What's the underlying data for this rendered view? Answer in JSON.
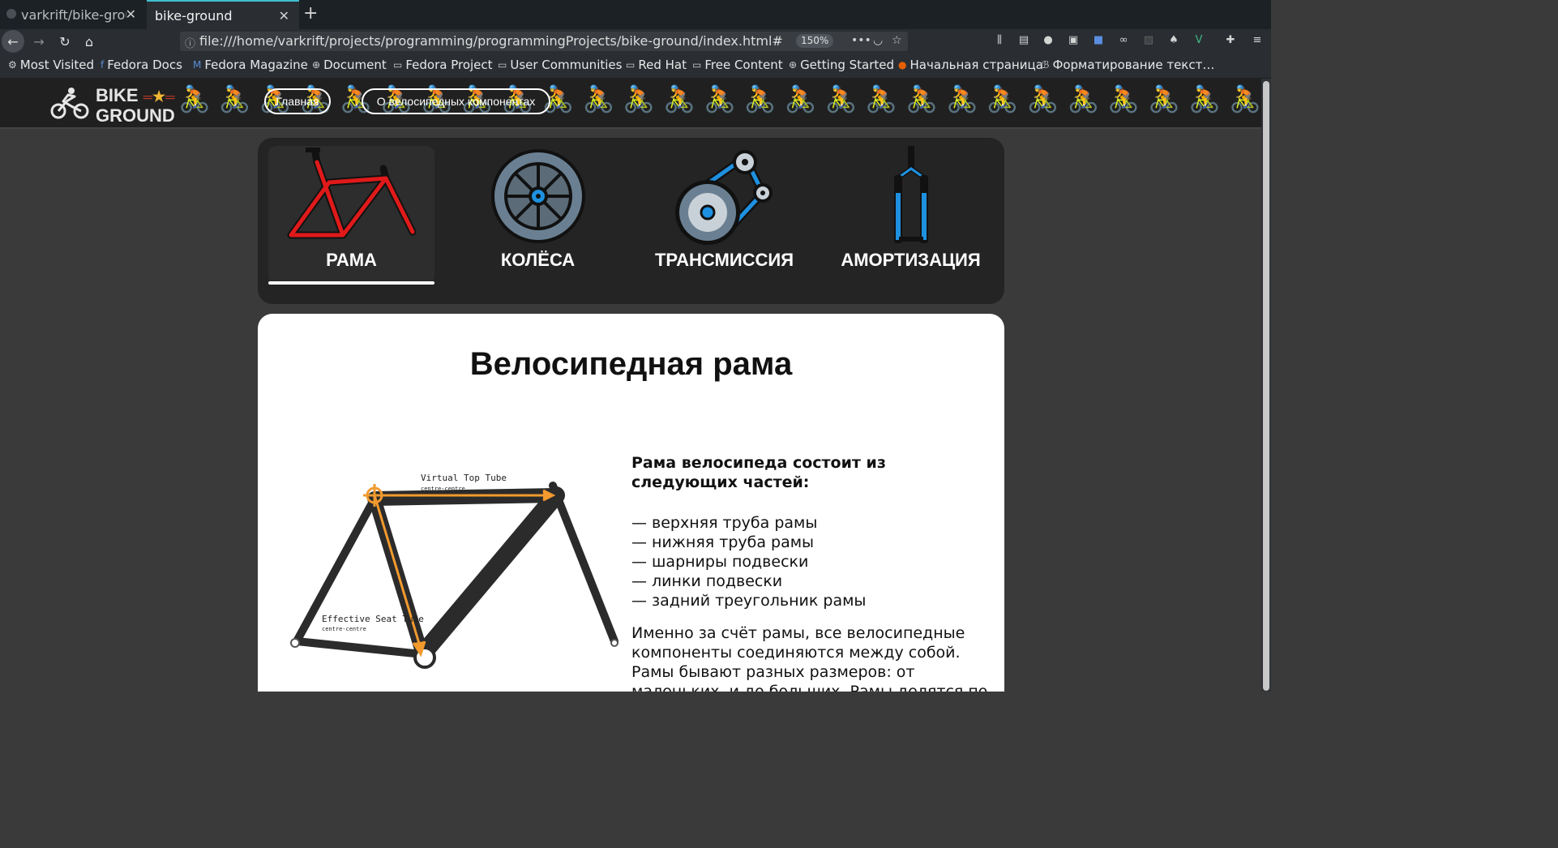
{
  "browser": {
    "tabs": [
      {
        "title": "varkrift/bike-grou",
        "active": false
      },
      {
        "title": "bike-ground",
        "active": true
      }
    ],
    "url": "file:///home/varkrift/projects/programming/programmingProjects/bike-ground/index.html#",
    "zoom": "150%",
    "bookmarks": [
      "Most Visited",
      "Fedora Docs",
      "Fedora Magazine",
      "Document",
      "Fedora Project",
      "User Communities",
      "Red Hat",
      "Free Content",
      "Getting Started",
      "Начальная страница",
      "Форматирование текст…"
    ]
  },
  "site": {
    "logo": {
      "line1": "BIKE",
      "line2": "GROUND"
    },
    "nav": {
      "home": "Главная",
      "about": "О велосипедных компонентах"
    }
  },
  "categories": [
    {
      "label": "РАМА",
      "active": true
    },
    {
      "label": "КОЛЁСА",
      "active": false
    },
    {
      "label": "ТРАНСМИССИЯ",
      "active": false
    },
    {
      "label": "АМОРТИЗАЦИЯ",
      "active": false
    }
  ],
  "article": {
    "title": "Велосипедная рама",
    "lead": "Рама велосипеда состоит из следующих частей:",
    "parts": [
      "— верхняя труба рамы",
      "— нижняя труба рамы",
      "— шарниры подвески",
      "— линки подвески",
      "— задний треугольник рамы"
    ],
    "body": "Именно за счёт рамы, все велосипедные компоненты соединяются между собой. Рамы бывают разных размеров: от маленьких, и до больших. Рамы делятся по трем классам:",
    "figure": {
      "top_label": "Virtual Top Tube",
      "top_sub": "centre-centre",
      "seat_label": "Effective Seat Tube",
      "seat_sub": "centre-centre"
    }
  },
  "colors": {
    "accent": "#3fbfcf",
    "frame_red": "#e01a1a",
    "blue": "#1e90e0",
    "orange": "#f29a2e"
  }
}
